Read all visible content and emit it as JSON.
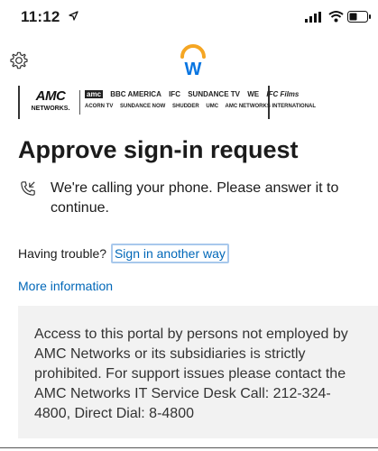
{
  "status_bar": {
    "time": "11:12"
  },
  "header": {
    "logo_letter": "W",
    "settings_icon": "gear-icon"
  },
  "brand_banner": {
    "main_brand_top": "AMC",
    "main_brand_bottom": "NETWORKS.",
    "row1": [
      "amc",
      "BBC AMERICA",
      "IFC",
      "SUNDANCE TV",
      "WE",
      "IFC Films"
    ],
    "row2": [
      "ACORN TV",
      "SUNDANCE NOW",
      "SHUDDER",
      "UMC",
      "AMC NETWORKS INTERNATIONAL"
    ]
  },
  "main": {
    "title": "Approve sign-in request",
    "call_message": "We're calling your phone. Please answer it to continue.",
    "trouble_label": "Having trouble?",
    "sign_in_another_way": "Sign in another way",
    "more_information": "More information"
  },
  "notice": {
    "text": "Access to this portal by persons not employed by AMC Networks or its subsidiaries is strictly prohibited. For support issues please contact the AMC Networks IT Service Desk Call: 212-324-4800, Direct Dial: 8-4800"
  },
  "colors": {
    "link": "#0067b8",
    "notice_bg": "#f2f2f2",
    "workday_orange": "#f5a623",
    "workday_blue": "#0875e1"
  }
}
